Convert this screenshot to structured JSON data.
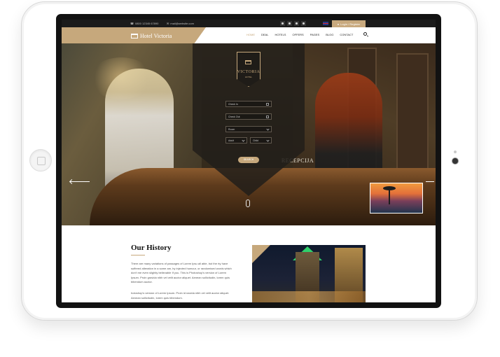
{
  "topbar": {
    "phone": "0800 12345 67890",
    "email": "mail@website.com",
    "social_icons": [
      "facebook-icon",
      "twitter-icon",
      "instagram-icon",
      "pinterest-icon"
    ],
    "login_label": "Login / Register"
  },
  "header": {
    "brand": "Hotel Victoria",
    "menu": [
      "HOME",
      "DEAL",
      "HOTELS",
      "OFFERS",
      "PAGES",
      "BLOG",
      "CONTACT"
    ],
    "active_menu": "HOME"
  },
  "hero": {
    "crest_name": "VICTORIA",
    "crest_sub": "HOTEL",
    "sign_text": "RECEPCIJA",
    "booking": {
      "check_in": "Check In",
      "check_out": "Check Out",
      "rooms": "Room",
      "adult": "Adult",
      "child": "Child",
      "search_label": "SEARCH"
    }
  },
  "history": {
    "title": "Our History",
    "paragraph1": "There are many variations of passages of Lorem Ipsu all able, but the rty have suffered alteration in a some am, by injected humour, or randomised words which don't me even slightly believable If you. This is Photoshop's version of Lorem Ipsum. Proin gravida nibh vel velit auctor aliquet. Aenean sollicitudin, lorem quis bibendum auctor.",
    "paragraph2": "hotoshop's version of Lorem Ipsum. Proin id navida nibh vel velit auctor aliquet. Aenean sollicitudin, lorem quis bibendum."
  },
  "colors": {
    "accent": "#c6a87c",
    "topbar": "#1b1b1b"
  }
}
